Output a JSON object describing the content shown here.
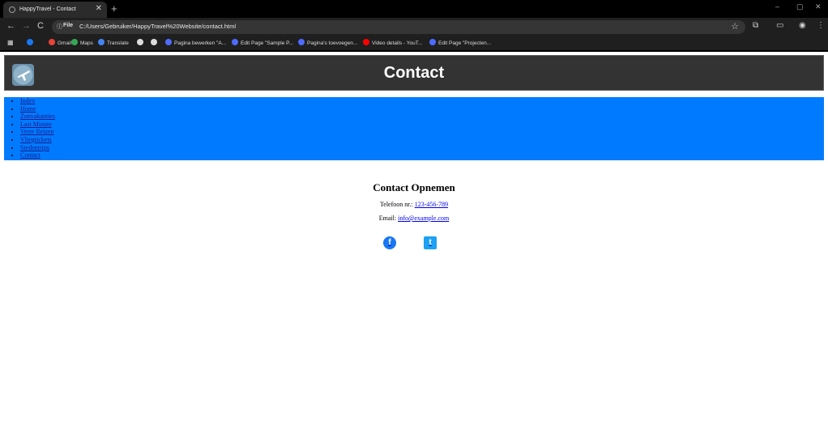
{
  "browser": {
    "tab_title": "HappyTravel - Contact",
    "tab_close": "✕",
    "new_tab": "+",
    "window_controls": [
      "–",
      "▢",
      "✕"
    ],
    "nav_back": "←",
    "nav_forward": "→",
    "nav_reload": "C",
    "omnibox_chip": "File",
    "url": "C:/Users/Gebruiker/HappyTravel%20Website/contact.html",
    "bookmarks": [
      {
        "label": "Gmail",
        "icon": "gmail-icon",
        "color": "#ea4335"
      },
      {
        "label": "Maps",
        "icon": "maps-icon",
        "color": "#34a853"
      },
      {
        "label": "Translate",
        "icon": "translate-icon",
        "color": "#4285f4"
      },
      {
        "label": "",
        "icon": "globe-icon",
        "color": "#dcdcdc"
      },
      {
        "label": "",
        "icon": "globe-icon",
        "color": "#dcdcdc"
      },
      {
        "label": "Pagina bewerken \"A...",
        "icon": "wordpress-icon",
        "color": "#4f6bff"
      },
      {
        "label": "Edit Page \"Sample P...",
        "icon": "wordpress-icon",
        "color": "#4f6bff"
      },
      {
        "label": "Pagina's toevoegen...",
        "icon": "wordpress-icon",
        "color": "#4f6bff"
      },
      {
        "label": "Video details - YouT...",
        "icon": "youtube-icon",
        "color": "#ff0000"
      },
      {
        "label": "Edit Page \"Projecten...",
        "icon": "wordpress-icon",
        "color": "#4f6bff"
      }
    ]
  },
  "header": {
    "title": "Contact",
    "logo": "airplane-logo"
  },
  "nav": {
    "items": [
      "Index",
      "Home",
      "Zonvakanties",
      "Last Minute",
      "Verre Reizen",
      "Vliegtickets",
      "Stedentrips",
      "Contact"
    ],
    "background": "#007bff"
  },
  "contact": {
    "heading": "Contact Opnemen",
    "phone_label": "Telefoon nr.:",
    "phone_value": "123-456-789",
    "email_label": "Email:",
    "email_value": "info@example.com",
    "social": [
      {
        "name": "facebook",
        "icon": "facebook-icon",
        "color": "#1877f2",
        "glyph": "f"
      },
      {
        "name": "twitter",
        "icon": "twitter-icon",
        "color": "#1da1f2",
        "glyph": "t"
      }
    ]
  }
}
